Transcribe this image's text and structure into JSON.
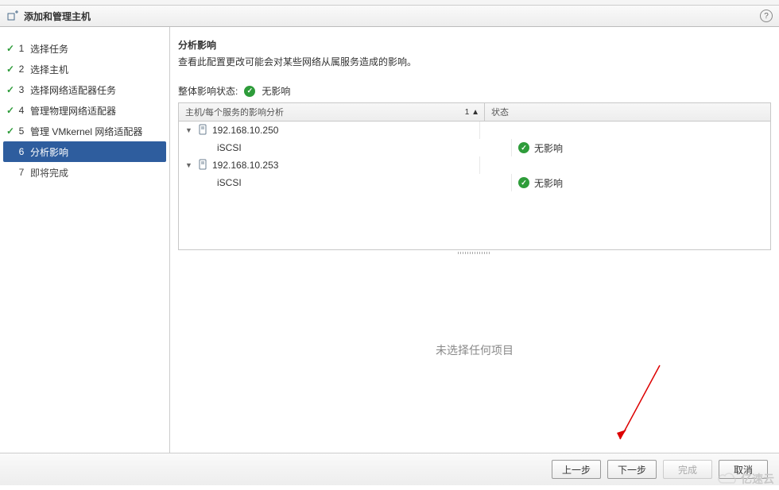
{
  "titlebar": {
    "icon": "add-host-icon",
    "title": "添加和管理主机"
  },
  "steps": [
    {
      "num": "1",
      "label": "选择任务",
      "state": "done"
    },
    {
      "num": "2",
      "label": "选择主机",
      "state": "done"
    },
    {
      "num": "3",
      "label": "选择网络适配器任务",
      "state": "done"
    },
    {
      "num": "4",
      "label": "管理物理网络适配器",
      "state": "done"
    },
    {
      "num": "5",
      "label": "管理 VMkernel 网络适配器",
      "state": "done"
    },
    {
      "num": "6",
      "label": "分析影响",
      "state": "active"
    },
    {
      "num": "7",
      "label": "即将完成",
      "state": "future"
    }
  ],
  "content": {
    "heading": "分析影响",
    "description": "查看此配置更改可能会对某些网络从属服务造成的影响。",
    "overall_label": "整体影响状态:",
    "overall_status_text": "无影响",
    "columns": {
      "host": "主机/每个服务的影响分析",
      "sort": "1 ▲",
      "status": "状态"
    },
    "rows": [
      {
        "type": "host",
        "text": "192.168.10.250"
      },
      {
        "type": "child",
        "text": "iSCSI",
        "status": "无影响"
      },
      {
        "type": "host",
        "text": "192.168.10.253"
      },
      {
        "type": "child",
        "text": "iSCSI",
        "status": "无影响"
      }
    ],
    "empty_message": "未选择任何项目"
  },
  "footer": {
    "back": "上一步",
    "next": "下一步",
    "finish": "完成",
    "cancel": "取消"
  },
  "watermark": "亿速云"
}
